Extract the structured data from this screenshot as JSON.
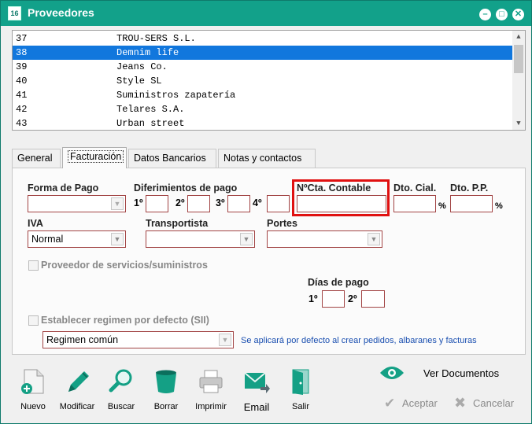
{
  "window": {
    "title": "Proveedores",
    "icon_text": "16"
  },
  "titlebar_buttons": [
    "minimize",
    "maximize",
    "close"
  ],
  "suppliers": [
    {
      "code": "37",
      "name": "TROU-SERS S.L.",
      "selected": false
    },
    {
      "code": "38",
      "name": "Demnim life",
      "selected": true
    },
    {
      "code": "39",
      "name": "Jeans Co.",
      "selected": false
    },
    {
      "code": "40",
      "name": "Style SL",
      "selected": false
    },
    {
      "code": "41",
      "name": "Suministros zapatería",
      "selected": false
    },
    {
      "code": "42",
      "name": "Telares S.A.",
      "selected": false
    },
    {
      "code": "43",
      "name": "Urban street",
      "selected": false
    }
  ],
  "tabs": [
    {
      "label": "General",
      "active": false
    },
    {
      "label": "Facturación",
      "active": true
    },
    {
      "label": "Datos Bancarios",
      "active": false
    },
    {
      "label": "Notas y contactos",
      "active": false
    }
  ],
  "facturacion": {
    "forma_pago_label": "Forma de Pago",
    "forma_pago_value": "",
    "diferimientos_label": "Diferimientos de pago",
    "diferimientos": [
      {
        "label": "1º",
        "value": ""
      },
      {
        "label": "2º",
        "value": ""
      },
      {
        "label": "3º",
        "value": ""
      },
      {
        "label": "4º",
        "value": ""
      }
    ],
    "cta_contable_label": "NºCta. Contable",
    "cta_contable_value": "",
    "dto_cial_label": "Dto. Cial.",
    "dto_pp_label": "Dto. P.P.",
    "percent_sign": "%",
    "iva_label": "IVA",
    "iva_value": "Normal",
    "transportista_label": "Transportista",
    "transportista_value": "",
    "portes_label": "Portes",
    "portes_value": "",
    "proveedor_servicios_label": "Proveedor de servicios/suministros",
    "proveedor_servicios_checked": false,
    "dias_pago_label": "Días de pago",
    "dias_pago": [
      {
        "label": "1º",
        "value": ""
      },
      {
        "label": "2º",
        "value": ""
      }
    ],
    "regimen_checkbox_label": "Establecer regimen por defecto (SII)",
    "regimen_checked": false,
    "regimen_value": "Regimen común",
    "regimen_hint": "Se aplicará por defecto al crear pedidos, albaranes y facturas"
  },
  "toolbar": [
    {
      "id": "nuevo",
      "label": "Nuevo",
      "icon": "new-document-icon"
    },
    {
      "id": "modificar",
      "label": "Modificar",
      "icon": "pen-icon"
    },
    {
      "id": "buscar",
      "label": "Buscar",
      "icon": "magnifier-icon"
    },
    {
      "id": "borrar",
      "label": "Borrar",
      "icon": "trash-icon"
    },
    {
      "id": "imprimir",
      "label": "Imprimir",
      "icon": "printer-icon"
    },
    {
      "id": "email",
      "label": "Email",
      "icon": "envelope-icon"
    },
    {
      "id": "salir",
      "label": "Salir",
      "icon": "exit-door-icon"
    }
  ],
  "actions": {
    "ver_documentos": "Ver Documentos",
    "aceptar": "Aceptar",
    "cancelar": "Cancelar"
  },
  "colors": {
    "titlebar": "#12a18a",
    "selection": "#1177dd",
    "required_border": "#a24444",
    "highlight": "#e01010",
    "hint_text": "#1a4fb0"
  }
}
